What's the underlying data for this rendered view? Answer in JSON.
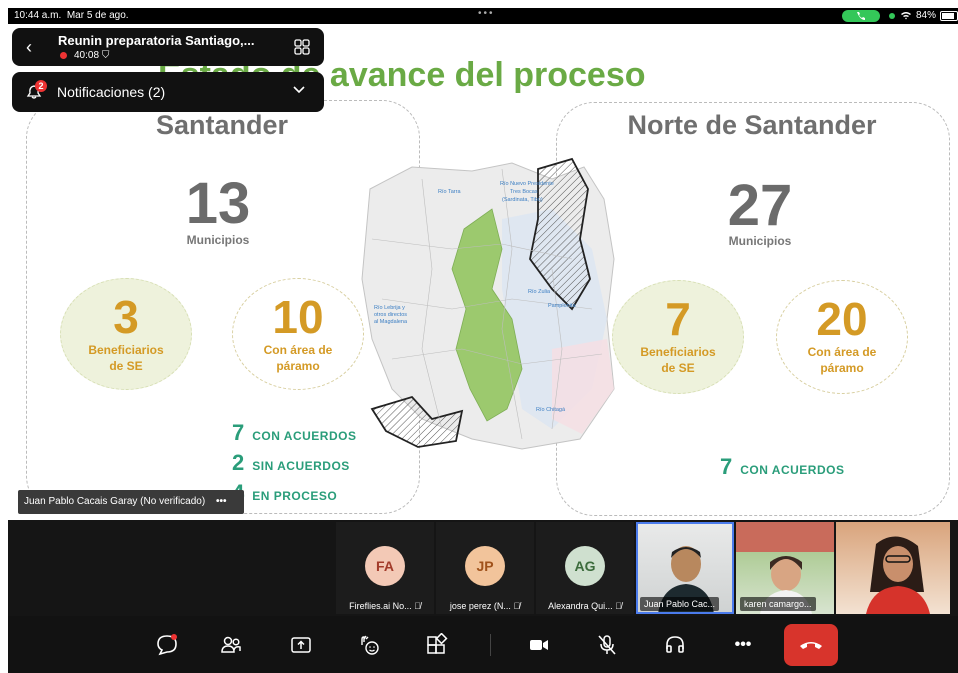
{
  "status": {
    "time": "10:44 a.m.",
    "date": "Mar 5 de ago.",
    "battery": "84%",
    "battery_fraction": 0.84
  },
  "meeting": {
    "title": "Reunin preparatoria Santiago,...",
    "elapsed": "40:08"
  },
  "notifications": {
    "label": "Notificaciones (2)",
    "count": "2"
  },
  "slide": {
    "title": "Estado de avance del proceso",
    "left": {
      "region": "Santander",
      "municipios_count": "13",
      "municipios_label": "Municipios",
      "beneficiarios_count": "3",
      "beneficiarios_label_1": "Beneficiarios",
      "beneficiarios_label_2": "de SE",
      "paramo_count": "10",
      "paramo_label_1": "Con área de",
      "paramo_label_2": "páramo",
      "stats": [
        {
          "n": "7",
          "label": "CON ACUERDOS"
        },
        {
          "n": "2",
          "label": "SIN ACUERDOS"
        },
        {
          "n": "4",
          "label": "EN PROCESO"
        }
      ]
    },
    "right": {
      "region": "Norte de Santander",
      "municipios_count": "27",
      "municipios_label": "Municipios",
      "beneficiarios_count": "7",
      "beneficiarios_label_1": "Beneficiarios",
      "beneficiarios_label_2": "de SE",
      "paramo_count": "20",
      "paramo_label_1": "Con área de",
      "paramo_label_2": "páramo",
      "stats": [
        {
          "n": "7",
          "label": "CON ACUERDOS"
        }
      ]
    },
    "map_labels": [
      "Río Tarra",
      "Río Nuevo Presidente",
      "Tres Bocas",
      "(Sardinata, Tibú)",
      "Río Zulia",
      "Pamplonita",
      "Río Chitagá",
      "Río Lebrija y",
      "otros directos",
      "al Magdalena"
    ]
  },
  "presenter_chip": "Juan Pablo Cacais Garay (No verificado)",
  "participants": [
    {
      "initials": "FA",
      "name": "Fireflies.ai No...",
      "color": "#f3c9b6",
      "text": "#a23b2a"
    },
    {
      "initials": "JP",
      "name": "jose perez (N...",
      "color": "#f2c49b",
      "text": "#a0521b"
    },
    {
      "initials": "AG",
      "name": "Alexandra Qui...",
      "color": "#cfe0cf",
      "text": "#3c6b3c"
    },
    {
      "name": "Juan Pablo Cac..."
    },
    {
      "name": "karen camargo..."
    },
    {
      "name": ""
    }
  ],
  "toolbar_icons": [
    "chat-icon",
    "participants-icon",
    "share-icon",
    "reactions-icon",
    "apps-icon",
    "camera-icon",
    "mic-muted-icon",
    "audio-icon",
    "more-icon",
    "leave-icon"
  ]
}
